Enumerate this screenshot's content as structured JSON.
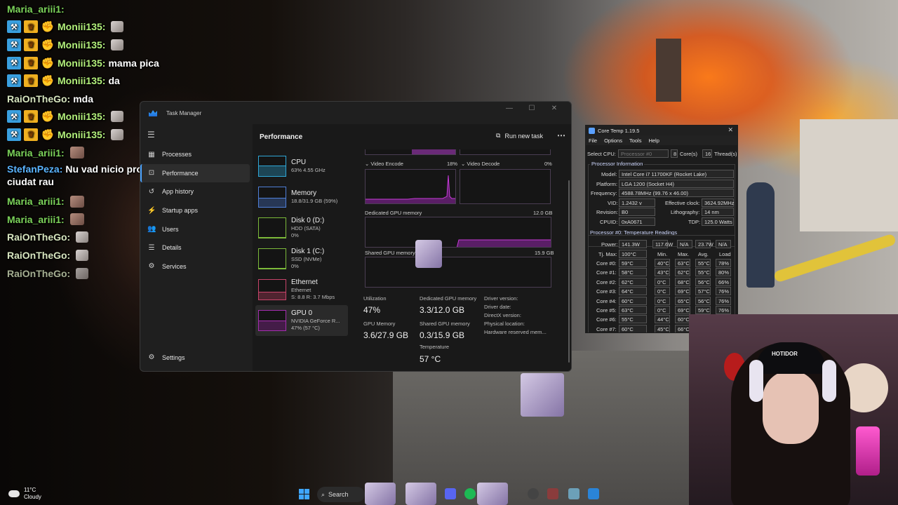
{
  "chat": [
    {
      "user": "Maria_ariii1:",
      "color": "#7cd35a",
      "badges": [],
      "message": "",
      "emote": false
    },
    {
      "user": "Moniii135:",
      "color": "#b3f07b",
      "badges": [
        "mod",
        "crown",
        "hype"
      ],
      "message": "",
      "emote": true
    },
    {
      "user": "Moniii135:",
      "color": "#b3f07b",
      "badges": [
        "mod",
        "crown",
        "hype"
      ],
      "message": "",
      "emote": true
    },
    {
      "user": "Moniii135:",
      "color": "#b3f07b",
      "badges": [
        "mod",
        "crown",
        "hype"
      ],
      "message": "mama pica",
      "emote": false
    },
    {
      "user": "Moniii135:",
      "color": "#b3f07b",
      "badges": [
        "mod",
        "crown",
        "hype"
      ],
      "message": "da",
      "emote": false
    },
    {
      "user": "RaiOnTheGo:",
      "color": "#d8e6c0",
      "badges": [],
      "message": "mda",
      "emote": false
    },
    {
      "user": "Moniii135:",
      "color": "#b3f07b",
      "badges": [
        "mod",
        "crown",
        "hype"
      ],
      "message": "",
      "emote": true
    },
    {
      "user": "Moniii135:",
      "color": "#b3f07b",
      "badges": [
        "mod",
        "crown",
        "hype"
      ],
      "message": "",
      "emote": true
    },
    {
      "user": "Maria_ariii1:",
      "color": "#7cd35a",
      "badges": [],
      "message": "",
      "emote": true
    },
    {
      "user": "StefanPeza:",
      "color": "#5ab4ff",
      "badges": [],
      "message": "Nu vad nicio problema e ciudat rau",
      "emote": false,
      "multiline": true
    },
    {
      "user": "Maria_ariii1:",
      "color": "#7cd35a",
      "badges": [],
      "message": "",
      "emote": true
    },
    {
      "user": "Maria_ariii1:",
      "color": "#7cd35a",
      "badges": [],
      "message": "",
      "emote": true
    },
    {
      "user": "RaiOnTheGo:",
      "color": "#d8e6c0",
      "badges": [],
      "message": "",
      "emote": true
    },
    {
      "user": "RaiOnTheGo:",
      "color": "#d8e6c0",
      "badges": [],
      "message": "",
      "emote": true
    },
    {
      "user": "RaiOnTheGo:",
      "color": "#d8e6c0",
      "badges": [],
      "message": "",
      "emote": true,
      "faded": true
    }
  ],
  "taskmanager": {
    "title": "Task Manager",
    "nav": [
      "Processes",
      "Performance",
      "App history",
      "Startup apps",
      "Users",
      "Details",
      "Services"
    ],
    "settings": "Settings",
    "header": "Performance",
    "run_task": "Run new task",
    "resources": [
      {
        "name": "CPU",
        "sub1": "63% 4.55 GHz",
        "sub2": "",
        "color": "#2fa8d8"
      },
      {
        "name": "Memory",
        "sub1": "18.8/31.9 GB (59%)",
        "sub2": "",
        "color": "#4f7fd8"
      },
      {
        "name": "Disk 0 (D:)",
        "sub1": "HDD (SATA)",
        "sub2": "0%",
        "color": "#7cba3a"
      },
      {
        "name": "Disk 1 (C:)",
        "sub1": "SSD (NVMe)",
        "sub2": "0%",
        "color": "#7cba3a"
      },
      {
        "name": "Ethernet",
        "sub1": "Ethernet",
        "sub2": "S: 8.8 R: 3.7 Mbps",
        "color": "#c8446a"
      },
      {
        "name": "GPU 0",
        "sub1": "NVIDIA GeForce R...",
        "sub2": "47% (57 °C)",
        "color": "#a52db0"
      }
    ],
    "gpu": {
      "video_encode_label": "Video Encode",
      "video_encode_pct": "18%",
      "video_decode_label": "Video Decode",
      "video_decode_pct": "0%",
      "dedicated_label": "Dedicated GPU memory",
      "dedicated_max": "12.0 GB",
      "shared_label": "Shared GPU memory",
      "shared_max": "15.9 GB",
      "stats": {
        "utilization_label": "Utilization",
        "utilization": "47%",
        "dedicated_mem_label": "Dedicated GPU memory",
        "dedicated_mem": "3.3/12.0 GB",
        "gpu_memory_label": "GPU Memory",
        "gpu_memory": "3.6/27.9 GB",
        "shared_mem_label": "Shared GPU memory",
        "shared_mem": "0.3/15.9 GB",
        "temperature_label": "Temperature",
        "temperature": "57 °C"
      },
      "driver_info": [
        "Driver version:",
        "Driver date:",
        "DirectX version:",
        "Physical location:",
        "Hardware reserved mem..."
      ]
    }
  },
  "coretemp": {
    "title": "Core Temp 1.19.5",
    "menu": [
      "File",
      "Options",
      "Tools",
      "Help"
    ],
    "select_cpu_label": "Select CPU:",
    "select_cpu_value": "Processor #0",
    "cores": "8",
    "cores_label": "Core(s)",
    "threads": "16",
    "threads_label": "Thread(s)",
    "proc_info_label": "Processor Information",
    "model_label": "Model:",
    "model": "Intel Core i7 11700KF (Rocket Lake)",
    "platform_label": "Platform:",
    "platform": "LGA 1200 (Socket H4)",
    "frequency_label": "Frequency:",
    "frequency": "4588.78MHz (99.76 x 46.00)",
    "vid_label": "VID:",
    "vid": "1.2432 v",
    "eff_clock_label": "Effective clock:",
    "eff_clock": "3624.92MHz",
    "revision_label": "Revision:",
    "revision": "B0",
    "litho_label": "Lithography:",
    "litho": "14 nm",
    "cpuid_label": "CPUID:",
    "cpuid": "0xA0671",
    "tdp_label": "TDP:",
    "tdp": "125.0 Watts",
    "temp_section": "Processor #0: Temperature Readings",
    "power_label": "Power:",
    "power": [
      "141.3W",
      "117.6W",
      "N/A",
      "23.7W",
      "N/A"
    ],
    "tjmax_label": "Tj. Max:",
    "tjmax": "100°C",
    "col_headers": [
      "Min.",
      "Max.",
      "Avg.",
      "Load"
    ],
    "cores_rows": [
      {
        "label": "Core #0:",
        "temp": "59°C",
        "min": "40°C",
        "max": "63°C",
        "avg": "55°C",
        "load": "78%"
      },
      {
        "label": "Core #1:",
        "temp": "58°C",
        "min": "43°C",
        "max": "62°C",
        "avg": "55°C",
        "load": "80%"
      },
      {
        "label": "Core #2:",
        "temp": "62°C",
        "min": "0°C",
        "max": "68°C",
        "avg": "56°C",
        "load": "66%"
      },
      {
        "label": "Core #3:",
        "temp": "64°C",
        "min": "0°C",
        "max": "69°C",
        "avg": "57°C",
        "load": "76%"
      },
      {
        "label": "Core #4:",
        "temp": "60°C",
        "min": "0°C",
        "max": "65°C",
        "avg": "56°C",
        "load": "76%"
      },
      {
        "label": "Core #5:",
        "temp": "63°C",
        "min": "0°C",
        "max": "69°C",
        "avg": "59°C",
        "load": "76%"
      },
      {
        "label": "Core #6:",
        "temp": "55°C",
        "min": "44°C",
        "max": "60°C",
        "avg": "",
        "load": ""
      },
      {
        "label": "Core #7:",
        "temp": "60°C",
        "min": "45°C",
        "max": "66°C",
        "avg": "",
        "load": ""
      }
    ]
  },
  "webcam": {
    "cap_text": "HOTIDOR"
  },
  "taskbar": {
    "temp": "11°C",
    "weather": "Cloudy",
    "search": "Search"
  }
}
